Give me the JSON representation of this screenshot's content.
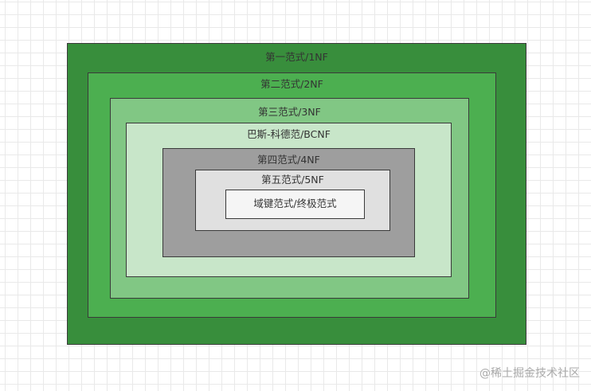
{
  "diagram": {
    "levels": [
      {
        "id": "nf1",
        "label": "第一范式/1NF",
        "color": "#388e3c"
      },
      {
        "id": "nf2",
        "label": "第二范式/2NF",
        "color": "#4caf50"
      },
      {
        "id": "nf3",
        "label": "第三范式/3NF",
        "color": "#81c784"
      },
      {
        "id": "bcnf",
        "label": "巴斯-科德范/BCNF",
        "color": "#c8e6c9"
      },
      {
        "id": "nf4",
        "label": "第四范式/4NF",
        "color": "#9e9e9e"
      },
      {
        "id": "nf5",
        "label": "第五范式/5NF",
        "color": "#e0e0e0"
      },
      {
        "id": "dknf",
        "label": "域键范式/终极范式",
        "color": "#f5f5f5"
      }
    ]
  },
  "watermark": "@稀土掘金技术社区"
}
